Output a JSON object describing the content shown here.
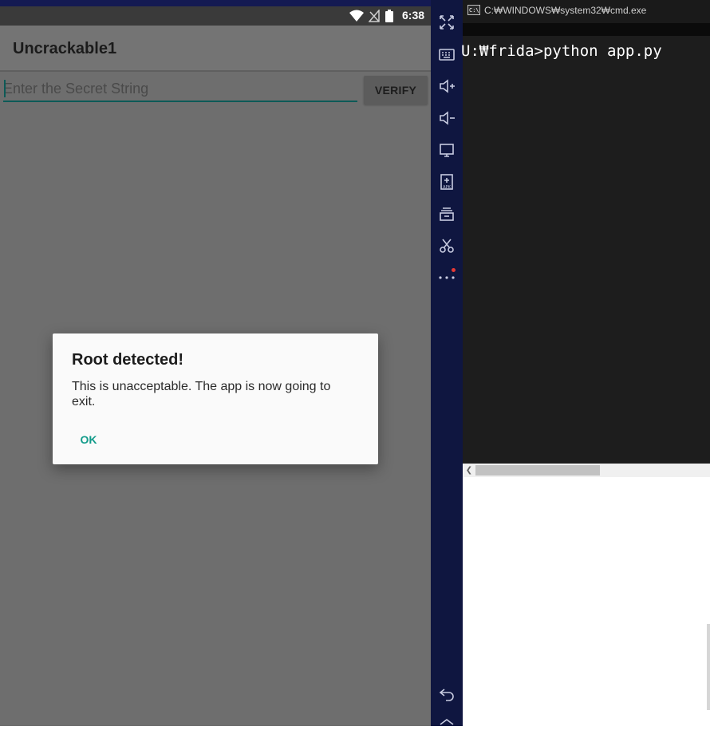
{
  "android": {
    "status_bar": {
      "time": "6:38",
      "icons": [
        "wifi-icon",
        "signal-off-icon",
        "battery-icon"
      ]
    },
    "app_title": "Uncrackable1",
    "input": {
      "placeholder": "Enter the Secret String",
      "value": ""
    },
    "verify_label": "VERIFY",
    "dialog": {
      "title": "Root detected!",
      "message": "This is unacceptable. The app is now going to exit.",
      "ok_label": "OK"
    }
  },
  "emulator_toolbar": {
    "icons": [
      "fullscreen-icon",
      "keyboard-icon",
      "volume-up-icon",
      "volume-down-icon",
      "screen-icon",
      "install-apk-icon",
      "multi-instance-icon",
      "screenshot-scissors-icon",
      "more-icon",
      "back-icon"
    ]
  },
  "cmd": {
    "title": "C:₩WINDOWS₩system32₩cmd.exe",
    "prompt": "U:₩frida>python app.py",
    "icon_text": "C:\\"
  },
  "colors": {
    "accent_teal": "#129b8a",
    "toolbar_bg": "#0f1640",
    "notification_dot": "#e53935"
  }
}
